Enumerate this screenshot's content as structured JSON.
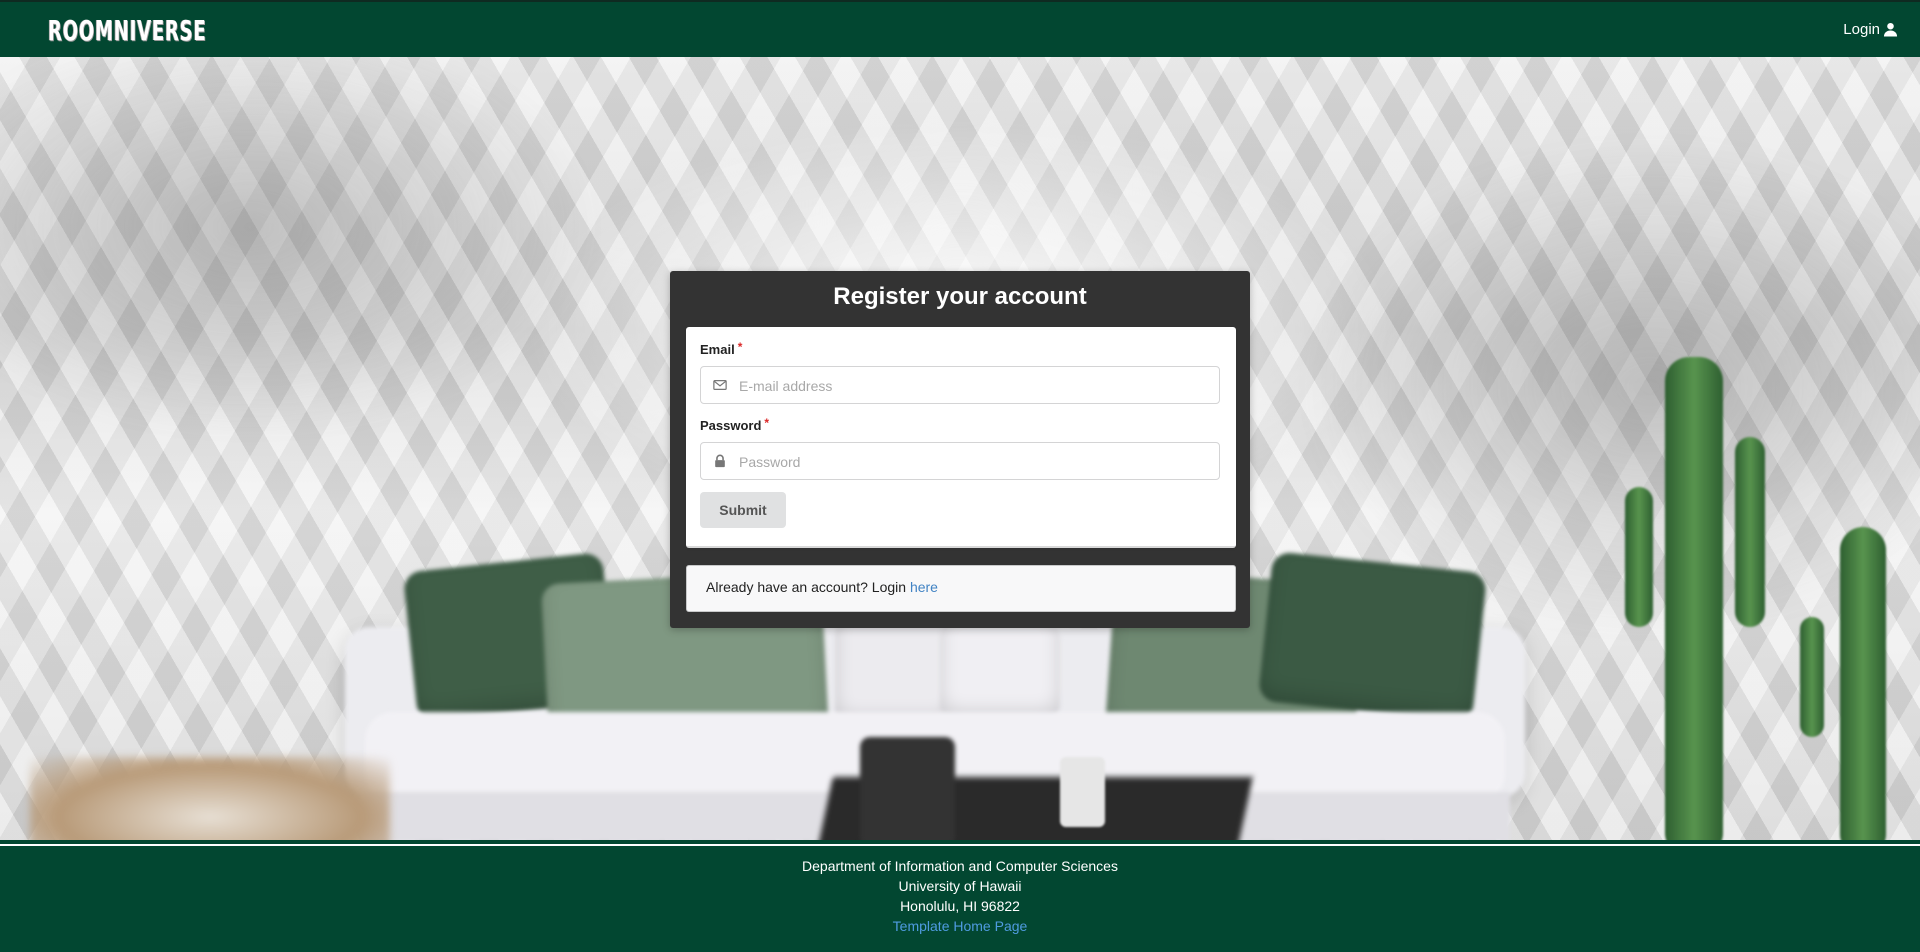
{
  "navbar": {
    "logo_text": "ROOMNIVERSE",
    "login_label": "Login",
    "login_icon": "user-icon",
    "background_color": "#024731"
  },
  "register": {
    "title": "Register your account",
    "email": {
      "label": "Email",
      "required_mark": "*",
      "placeholder": "E-mail address",
      "value": "",
      "icon": "envelope-icon"
    },
    "password": {
      "label": "Password",
      "required_mark": "*",
      "placeholder": "Password",
      "value": "",
      "icon": "lock-icon"
    },
    "submit_label": "Submit",
    "login_prompt": "Already have an account? Login",
    "login_link": "here"
  },
  "footer": {
    "line1": "Department of Information and Computer Sciences",
    "line2": "University of Hawaii",
    "line3": "Honolulu, HI 96822",
    "link_text": "Template Home Page",
    "background_color": "#024731"
  },
  "colors": {
    "accent_link": "#4183c4",
    "card_background": "#333333",
    "required_marker": "#db2828"
  }
}
